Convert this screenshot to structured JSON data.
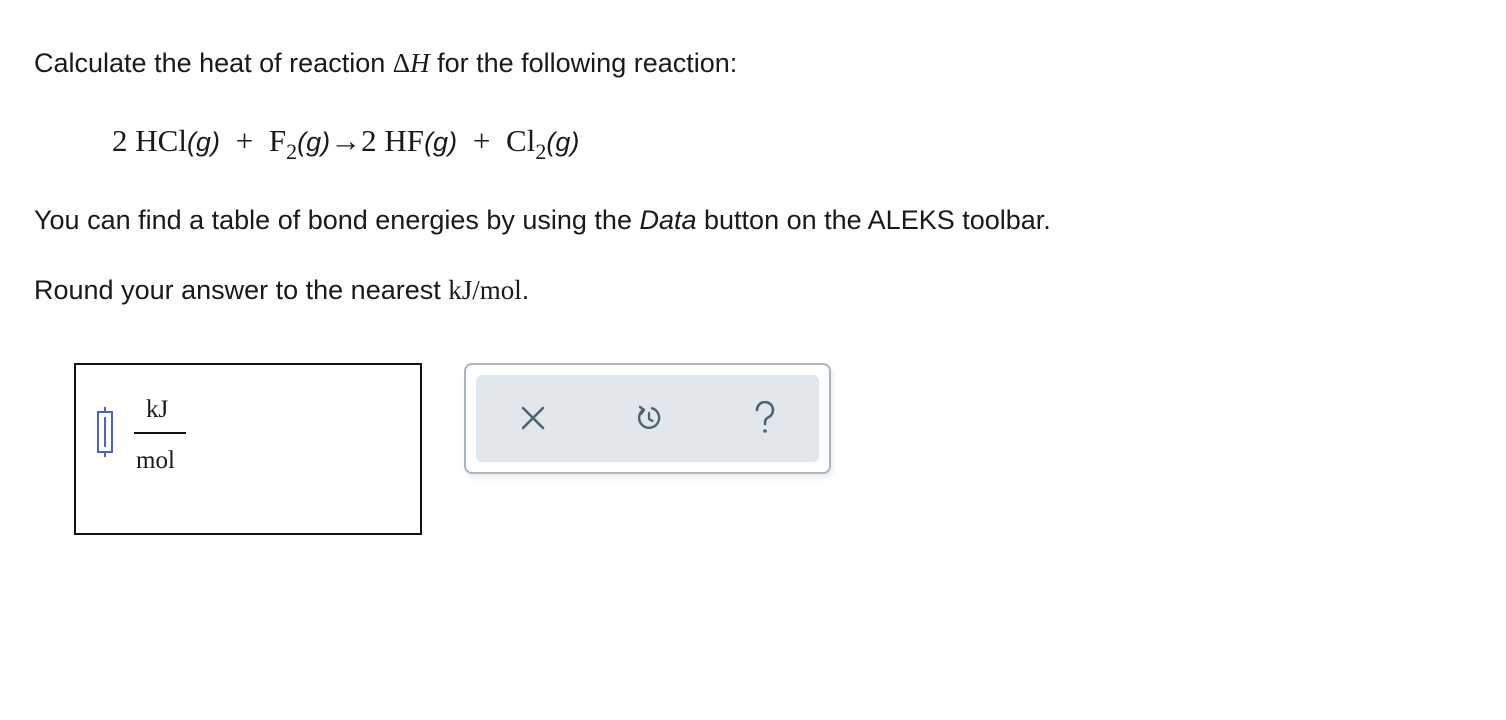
{
  "question": {
    "line1_before": "Calculate the heat of reaction ",
    "delta_symbol": "Δ",
    "h_symbol": "H",
    "line1_after": " for the following reaction:",
    "reaction": {
      "reactant1_coef": "2",
      "reactant1": "HCl",
      "reactant1_phase": "(g)",
      "plus1": "+",
      "reactant2": "F",
      "reactant2_sub": "2",
      "reactant2_phase": "(g)",
      "arrow": "→",
      "product1_coef": "2",
      "product1": "HF",
      "product1_phase": "(g)",
      "plus2": "+",
      "product2": "Cl",
      "product2_sub": "2",
      "product2_phase": "(g)"
    },
    "line2_before": "You can find a table of bond energies by using the ",
    "line2_em": "Data",
    "line2_after": " button on the ALEKS toolbar.",
    "line3_before": "Round your answer to the nearest ",
    "line3_unit": "kJ/mol",
    "line3_after": "."
  },
  "answer": {
    "input_value": "",
    "unit_numerator": "kJ",
    "unit_denominator": "mol"
  },
  "toolbar": {
    "clear_icon": "x-icon",
    "undo_icon": "undo-icon",
    "help_icon": "help-icon",
    "icon_color": "#4b6471",
    "background": "#e1e7eb"
  }
}
